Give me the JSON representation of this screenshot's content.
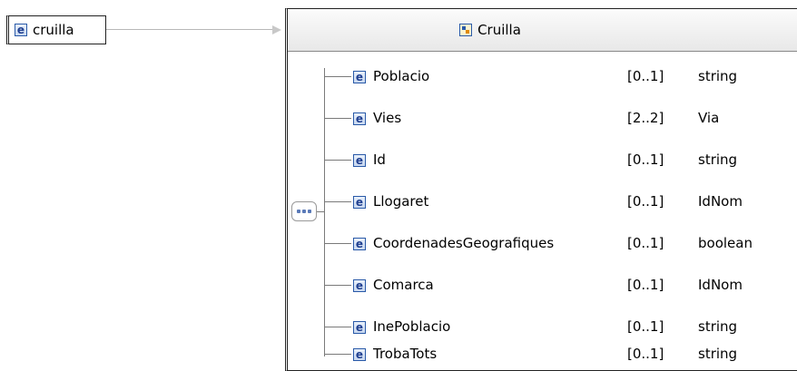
{
  "root_element": {
    "icon": "e",
    "name": "cruilla"
  },
  "type_box": {
    "title": "Cruilla"
  },
  "elements": [
    {
      "icon": "e",
      "name": "Poblacio",
      "cardinality": "[0..1]",
      "type": "string"
    },
    {
      "icon": "e",
      "name": "Vies",
      "cardinality": "[2..2]",
      "type": "Via"
    },
    {
      "icon": "e",
      "name": "Id",
      "cardinality": "[0..1]",
      "type": "string"
    },
    {
      "icon": "e",
      "name": "Llogaret",
      "cardinality": "[0..1]",
      "type": "IdNom"
    },
    {
      "icon": "e",
      "name": "CoordenadesGeografiques",
      "cardinality": "[0..1]",
      "type": "boolean"
    },
    {
      "icon": "e",
      "name": "Comarca",
      "cardinality": "[0..1]",
      "type": "IdNom"
    },
    {
      "icon": "e",
      "name": "InePoblacio",
      "cardinality": "[0..1]",
      "type": "string"
    },
    {
      "icon": "e",
      "name": "TrobaTots",
      "cardinality": "[0..1]",
      "type": "string"
    }
  ]
}
